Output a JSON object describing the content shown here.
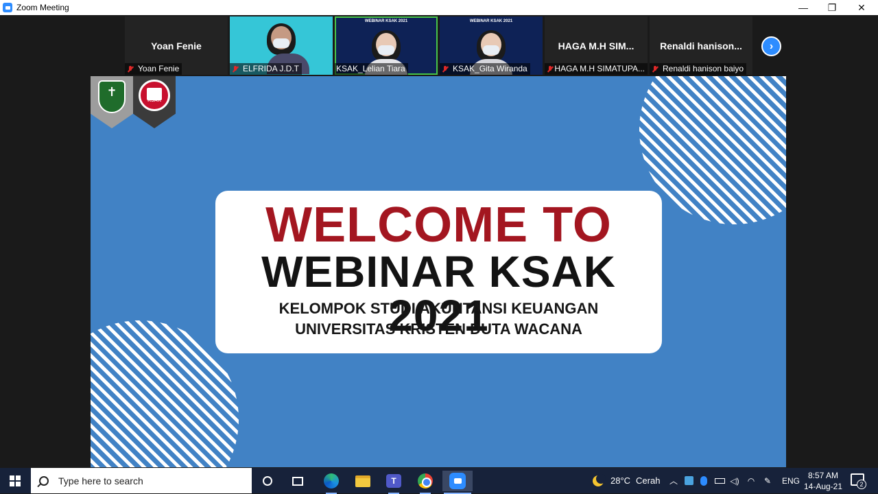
{
  "window": {
    "title": "Zoom Meeting",
    "minimize_glyph": "—",
    "restore_glyph": "❐",
    "close_glyph": "✕"
  },
  "gallery": {
    "tiles": [
      {
        "display_name": "Yoan Fenie",
        "label": "Yoan Fenie",
        "muted": true,
        "video": false
      },
      {
        "display_name": "",
        "label": "ELFRIDA J.D.T",
        "muted": true,
        "video": true
      },
      {
        "display_name": "",
        "label": "KSAK_Lelian Tiara",
        "muted": false,
        "video": true,
        "active_speaker": true
      },
      {
        "display_name": "",
        "label": "KSAK_Gita Wiranda",
        "muted": true,
        "video": true
      },
      {
        "display_name": "HAGA M.H SIM...",
        "label": "HAGA M.H SIMATUPA...",
        "muted": true,
        "video": false
      },
      {
        "display_name": "Renaldi hanison...",
        "label": "Renaldi hanison baiyo",
        "muted": true,
        "video": false
      }
    ],
    "tile_banner_text": "WEBINAR KSAK 2021",
    "next_page_glyph": "›"
  },
  "slide": {
    "line1": "WELCOME TO",
    "line2": "WEBINAR KSAK 2021",
    "line3": "KELOMPOK STUDI AKUNTANSI KEUANGAN",
    "line4": "UNIVERSITAS KRISTEN DUTA WACANA",
    "ksak_logo_text": "KSAK",
    "colors": {
      "background": "#4182c5",
      "accent_red": "#a31620",
      "card": "#ffffff"
    }
  },
  "taskbar": {
    "search_placeholder": "Type here to search",
    "weather_temp": "28°C",
    "weather_desc": "Cerah",
    "language": "ENG",
    "time": "8:57 AM",
    "date": "14-Aug-21",
    "notification_count": "2"
  }
}
